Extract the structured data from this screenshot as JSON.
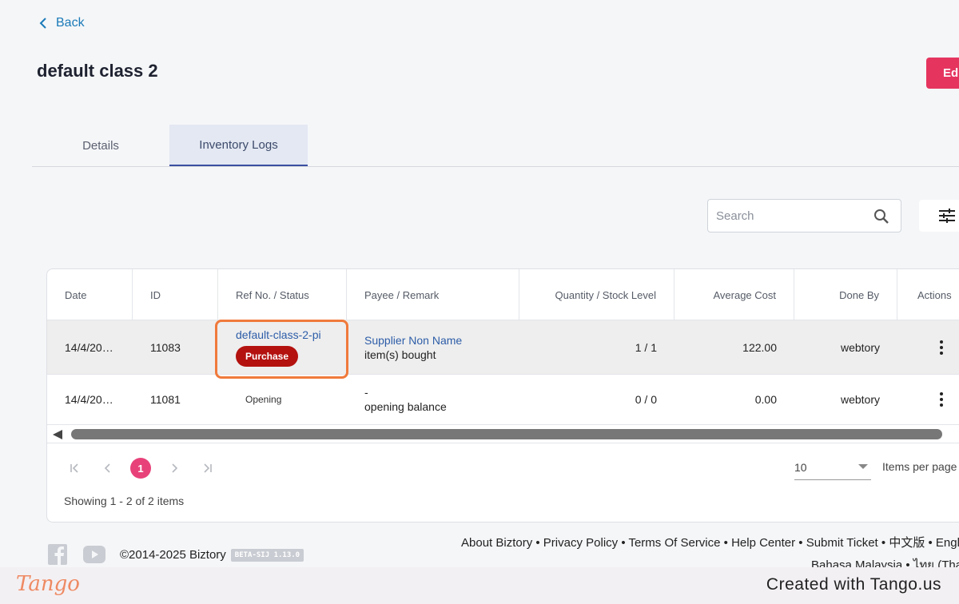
{
  "nav": {
    "back_label": "Back"
  },
  "page": {
    "title": "default class 2",
    "edit_label": "Edit"
  },
  "tabs": [
    {
      "label": "Details",
      "active": false
    },
    {
      "label": "Inventory Logs",
      "active": true
    }
  ],
  "search": {
    "placeholder": "Search"
  },
  "table": {
    "columns": [
      "Date",
      "ID",
      "Ref No. / Status",
      "Payee / Remark",
      "Quantity / Stock Level",
      "Average Cost",
      "Done By",
      "Actions"
    ],
    "rows": [
      {
        "date": "14/4/20…",
        "id": "11083",
        "ref": "default-class-2-pi",
        "status": "Purchase",
        "payee": "Supplier Non Name",
        "remark": "item(s) bought",
        "qty_stock": "1 / 1",
        "avg_cost": "122.00",
        "done_by": "webtory"
      },
      {
        "date": "14/4/20…",
        "id": "11081",
        "ref": "",
        "status": "Opening",
        "payee": "-",
        "remark": "opening balance",
        "qty_stock": "0 / 0",
        "avg_cost": "0.00",
        "done_by": "webtory"
      }
    ]
  },
  "pagination": {
    "current_page": "1",
    "items_per_page": "10",
    "items_per_page_label": "Items per page",
    "showing": "Showing 1 - 2 of 2 items"
  },
  "footer": {
    "copyright": "©2014-2025 Biztory",
    "version": "BETA-SIJ 1.13.0",
    "links_line1": "About Biztory • Privacy Policy • Terms Of Service • Help Center • Submit Ticket • 中文版 • English",
    "links_line2": "Bahasa Malaysia • ไทย (Thai)"
  },
  "tango": {
    "logo": "Tango",
    "credit": "Created with Tango.us"
  },
  "colors": {
    "accent_pink": "#e5355f",
    "link_blue": "#1a7ab8",
    "purchase_badge": "#b3120f",
    "highlight_orange": "#f07a3c"
  },
  "icons": [
    "chevron-left-icon",
    "search-icon",
    "sliders-icon",
    "kebab-icon",
    "facebook-icon",
    "youtube-icon",
    "first-page-icon",
    "prev-page-icon",
    "next-page-icon",
    "last-page-icon"
  ]
}
